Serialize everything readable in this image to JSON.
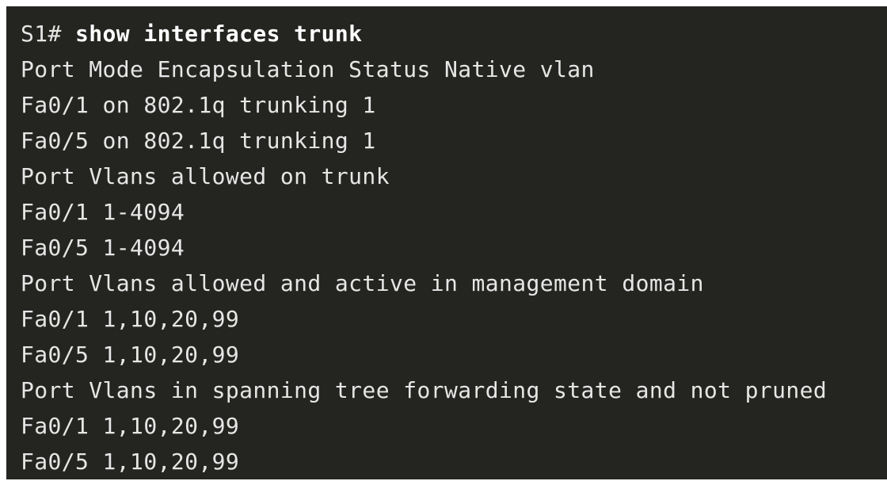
{
  "terminal": {
    "prompt": "S1# ",
    "command": "show interfaces trunk",
    "output": [
      "Port Mode Encapsulation Status Native vlan",
      "Fa0/1 on 802.1q trunking 1",
      "Fa0/5 on 802.1q trunking 1",
      "Port Vlans allowed on trunk",
      "Fa0/1 1-4094",
      "Fa0/5 1-4094",
      "Port Vlans allowed and active in management domain",
      "Fa0/1 1,10,20,99",
      "Fa0/5 1,10,20,99",
      "Port Vlans in spanning tree forwarding state and not pruned",
      "Fa0/1 1,10,20,99",
      "Fa0/5 1,10,20,99"
    ],
    "colors": {
      "background": "#242421",
      "text": "#e6e6e6"
    }
  }
}
